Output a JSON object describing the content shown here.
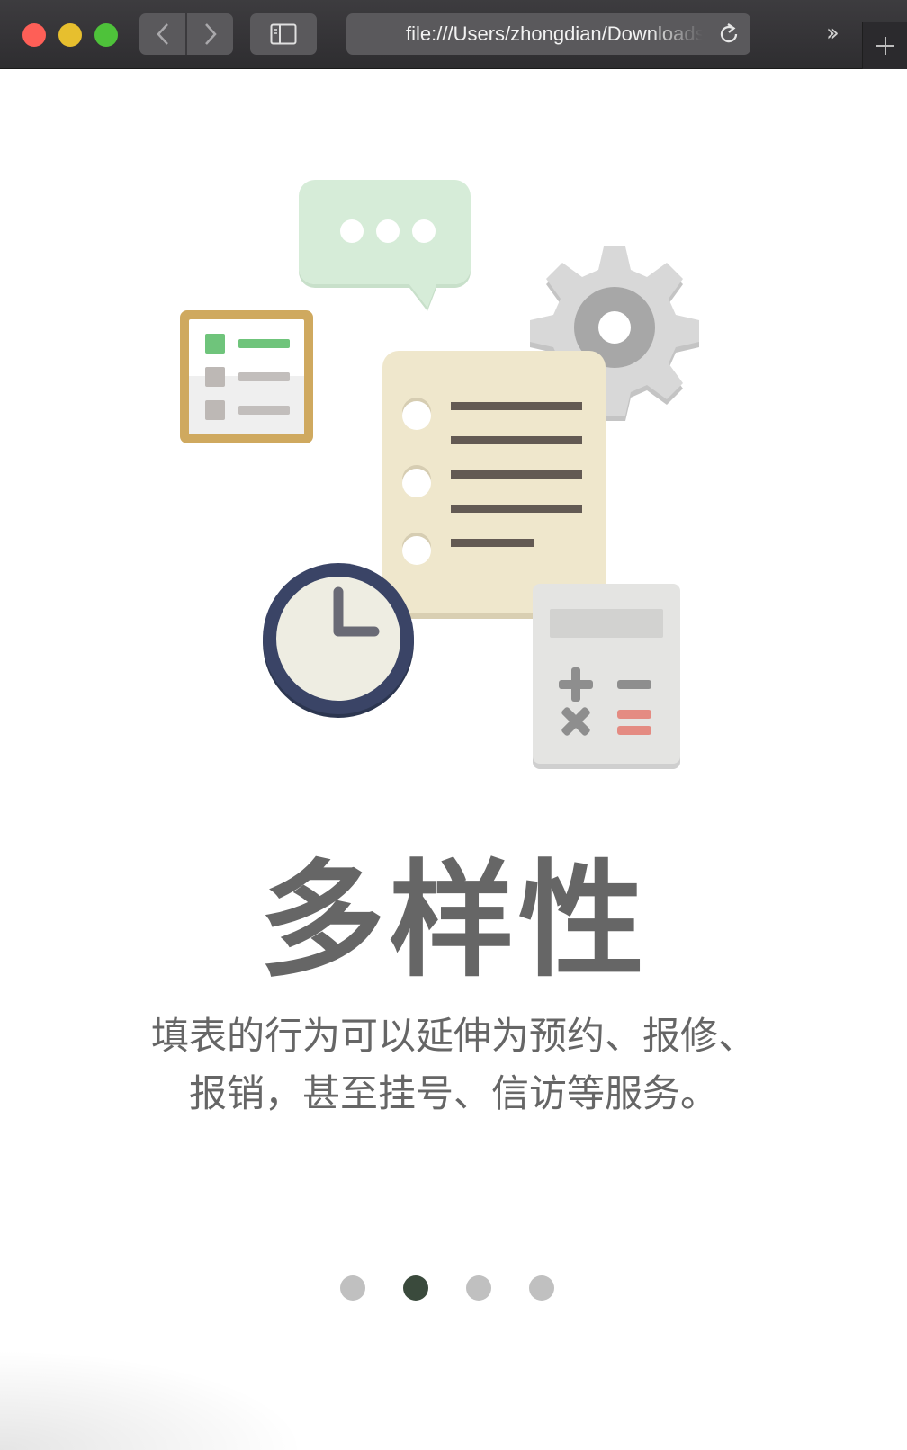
{
  "browser": {
    "url": "file:///Users/zhongdian/Downloads/index.html",
    "icons": [
      "back-icon",
      "forward-icon",
      "sidebar-icon",
      "reload-icon",
      "more-chevrons-icon",
      "new-tab-icon"
    ]
  },
  "slide": {
    "title": "多样性",
    "description_lines": [
      "填表的行为可以延伸为预约、报修、",
      "报销，甚至挂号、信访等服务。"
    ]
  },
  "pagination": {
    "total": 4,
    "active_index": 1
  },
  "colors": {
    "title": "#666666",
    "dot_inactive": "#c0c0c0",
    "dot_active": "#3a4a3c",
    "traffic_red": "#fe5f57",
    "traffic_yellow": "#e7bf2e",
    "traffic_green": "#4ec23a"
  }
}
